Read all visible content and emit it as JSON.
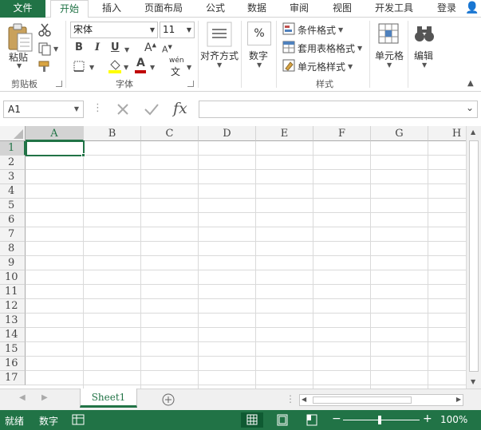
{
  "tabs": [
    "文件",
    "开始",
    "插入",
    "页面布局",
    "公式",
    "数据",
    "审阅",
    "视图",
    "开发工具",
    "登录"
  ],
  "ribbon": {
    "clipboard": {
      "paste": "粘贴",
      "group": "剪贴板"
    },
    "font": {
      "name": "宋体",
      "size": "11",
      "bold": "B",
      "italic": "I",
      "underline": "U",
      "phonetic": "wén",
      "group": "字体"
    },
    "alignment": {
      "label": "对齐方式"
    },
    "number": {
      "label": "数字",
      "symbol": "%"
    },
    "styles": {
      "conditional": "条件格式",
      "table": "套用表格格式",
      "cell": "单元格样式",
      "group": "样式"
    },
    "cells": {
      "label": "单元格"
    },
    "editing": {
      "label": "编辑"
    }
  },
  "formula_bar": {
    "name_box": "A1",
    "fx": "fx",
    "value": ""
  },
  "columns": [
    "A",
    "B",
    "C",
    "D",
    "E",
    "F",
    "G",
    "H"
  ],
  "rows": [
    "1",
    "2",
    "3",
    "4",
    "5",
    "6",
    "7",
    "8",
    "9",
    "10",
    "11",
    "12",
    "13",
    "14",
    "15",
    "16",
    "17"
  ],
  "sheets": [
    "Sheet1"
  ],
  "status": {
    "ready": "就绪",
    "mode": "数字",
    "zoom": "100%"
  },
  "colors": {
    "accent": "#217346"
  }
}
